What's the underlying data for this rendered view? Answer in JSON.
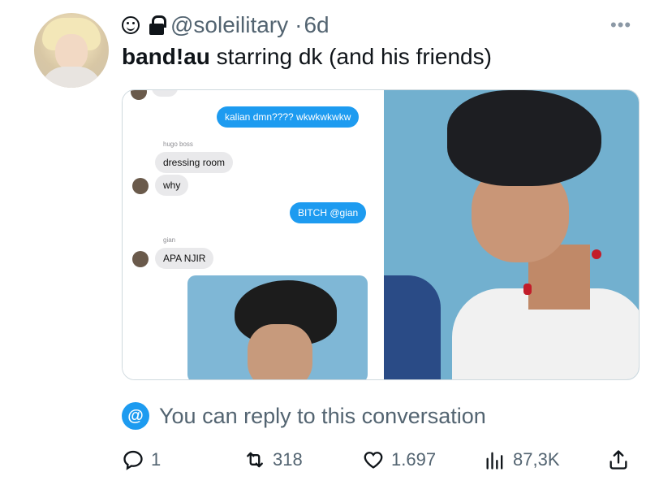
{
  "author": {
    "handle": "@soleilitary",
    "separator": "·",
    "age": "6d"
  },
  "tweet": {
    "bold_text": "band!au",
    "text": " starring dk (and his friends)"
  },
  "media": {
    "chat": {
      "partial_top": "····",
      "msg1": "kalian dmn???? wkwkwkwkw",
      "name1": "hugo boss",
      "msg2": "dressing room",
      "msg3": "why",
      "msg4": "BITCH @gian",
      "name2": "gian",
      "msg5": "APA NJIR"
    }
  },
  "reply_notice": {
    "icon": "@",
    "text": "You can reply to this conversation"
  },
  "actions": {
    "replies": "1",
    "retweets": "318",
    "likes": "1.697",
    "views": "87,3K"
  },
  "colors": {
    "accent": "#1d9bf0",
    "muted": "#536471"
  }
}
